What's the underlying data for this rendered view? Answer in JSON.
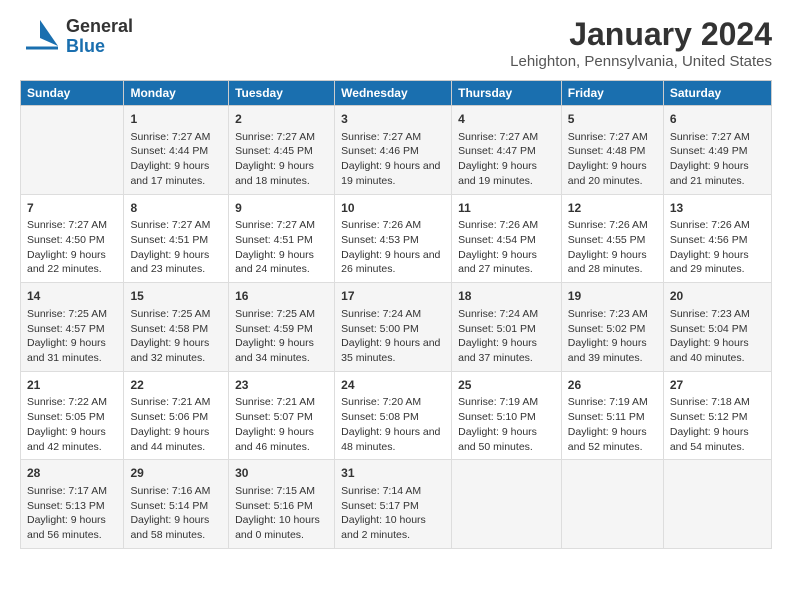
{
  "header": {
    "logo_general": "General",
    "logo_blue": "Blue",
    "title": "January 2024",
    "subtitle": "Lehighton, Pennsylvania, United States"
  },
  "columns": [
    "Sunday",
    "Monday",
    "Tuesday",
    "Wednesday",
    "Thursday",
    "Friday",
    "Saturday"
  ],
  "weeks": [
    [
      {
        "day": "",
        "sunrise": "",
        "sunset": "",
        "daylight": ""
      },
      {
        "day": "1",
        "sunrise": "Sunrise: 7:27 AM",
        "sunset": "Sunset: 4:44 PM",
        "daylight": "Daylight: 9 hours and 17 minutes."
      },
      {
        "day": "2",
        "sunrise": "Sunrise: 7:27 AM",
        "sunset": "Sunset: 4:45 PM",
        "daylight": "Daylight: 9 hours and 18 minutes."
      },
      {
        "day": "3",
        "sunrise": "Sunrise: 7:27 AM",
        "sunset": "Sunset: 4:46 PM",
        "daylight": "Daylight: 9 hours and 19 minutes."
      },
      {
        "day": "4",
        "sunrise": "Sunrise: 7:27 AM",
        "sunset": "Sunset: 4:47 PM",
        "daylight": "Daylight: 9 hours and 19 minutes."
      },
      {
        "day": "5",
        "sunrise": "Sunrise: 7:27 AM",
        "sunset": "Sunset: 4:48 PM",
        "daylight": "Daylight: 9 hours and 20 minutes."
      },
      {
        "day": "6",
        "sunrise": "Sunrise: 7:27 AM",
        "sunset": "Sunset: 4:49 PM",
        "daylight": "Daylight: 9 hours and 21 minutes."
      }
    ],
    [
      {
        "day": "7",
        "sunrise": "Sunrise: 7:27 AM",
        "sunset": "Sunset: 4:50 PM",
        "daylight": "Daylight: 9 hours and 22 minutes."
      },
      {
        "day": "8",
        "sunrise": "Sunrise: 7:27 AM",
        "sunset": "Sunset: 4:51 PM",
        "daylight": "Daylight: 9 hours and 23 minutes."
      },
      {
        "day": "9",
        "sunrise": "Sunrise: 7:27 AM",
        "sunset": "Sunset: 4:51 PM",
        "daylight": "Daylight: 9 hours and 24 minutes."
      },
      {
        "day": "10",
        "sunrise": "Sunrise: 7:26 AM",
        "sunset": "Sunset: 4:53 PM",
        "daylight": "Daylight: 9 hours and 26 minutes."
      },
      {
        "day": "11",
        "sunrise": "Sunrise: 7:26 AM",
        "sunset": "Sunset: 4:54 PM",
        "daylight": "Daylight: 9 hours and 27 minutes."
      },
      {
        "day": "12",
        "sunrise": "Sunrise: 7:26 AM",
        "sunset": "Sunset: 4:55 PM",
        "daylight": "Daylight: 9 hours and 28 minutes."
      },
      {
        "day": "13",
        "sunrise": "Sunrise: 7:26 AM",
        "sunset": "Sunset: 4:56 PM",
        "daylight": "Daylight: 9 hours and 29 minutes."
      }
    ],
    [
      {
        "day": "14",
        "sunrise": "Sunrise: 7:25 AM",
        "sunset": "Sunset: 4:57 PM",
        "daylight": "Daylight: 9 hours and 31 minutes."
      },
      {
        "day": "15",
        "sunrise": "Sunrise: 7:25 AM",
        "sunset": "Sunset: 4:58 PM",
        "daylight": "Daylight: 9 hours and 32 minutes."
      },
      {
        "day": "16",
        "sunrise": "Sunrise: 7:25 AM",
        "sunset": "Sunset: 4:59 PM",
        "daylight": "Daylight: 9 hours and 34 minutes."
      },
      {
        "day": "17",
        "sunrise": "Sunrise: 7:24 AM",
        "sunset": "Sunset: 5:00 PM",
        "daylight": "Daylight: 9 hours and 35 minutes."
      },
      {
        "day": "18",
        "sunrise": "Sunrise: 7:24 AM",
        "sunset": "Sunset: 5:01 PM",
        "daylight": "Daylight: 9 hours and 37 minutes."
      },
      {
        "day": "19",
        "sunrise": "Sunrise: 7:23 AM",
        "sunset": "Sunset: 5:02 PM",
        "daylight": "Daylight: 9 hours and 39 minutes."
      },
      {
        "day": "20",
        "sunrise": "Sunrise: 7:23 AM",
        "sunset": "Sunset: 5:04 PM",
        "daylight": "Daylight: 9 hours and 40 minutes."
      }
    ],
    [
      {
        "day": "21",
        "sunrise": "Sunrise: 7:22 AM",
        "sunset": "Sunset: 5:05 PM",
        "daylight": "Daylight: 9 hours and 42 minutes."
      },
      {
        "day": "22",
        "sunrise": "Sunrise: 7:21 AM",
        "sunset": "Sunset: 5:06 PM",
        "daylight": "Daylight: 9 hours and 44 minutes."
      },
      {
        "day": "23",
        "sunrise": "Sunrise: 7:21 AM",
        "sunset": "Sunset: 5:07 PM",
        "daylight": "Daylight: 9 hours and 46 minutes."
      },
      {
        "day": "24",
        "sunrise": "Sunrise: 7:20 AM",
        "sunset": "Sunset: 5:08 PM",
        "daylight": "Daylight: 9 hours and 48 minutes."
      },
      {
        "day": "25",
        "sunrise": "Sunrise: 7:19 AM",
        "sunset": "Sunset: 5:10 PM",
        "daylight": "Daylight: 9 hours and 50 minutes."
      },
      {
        "day": "26",
        "sunrise": "Sunrise: 7:19 AM",
        "sunset": "Sunset: 5:11 PM",
        "daylight": "Daylight: 9 hours and 52 minutes."
      },
      {
        "day": "27",
        "sunrise": "Sunrise: 7:18 AM",
        "sunset": "Sunset: 5:12 PM",
        "daylight": "Daylight: 9 hours and 54 minutes."
      }
    ],
    [
      {
        "day": "28",
        "sunrise": "Sunrise: 7:17 AM",
        "sunset": "Sunset: 5:13 PM",
        "daylight": "Daylight: 9 hours and 56 minutes."
      },
      {
        "day": "29",
        "sunrise": "Sunrise: 7:16 AM",
        "sunset": "Sunset: 5:14 PM",
        "daylight": "Daylight: 9 hours and 58 minutes."
      },
      {
        "day": "30",
        "sunrise": "Sunrise: 7:15 AM",
        "sunset": "Sunset: 5:16 PM",
        "daylight": "Daylight: 10 hours and 0 minutes."
      },
      {
        "day": "31",
        "sunrise": "Sunrise: 7:14 AM",
        "sunset": "Sunset: 5:17 PM",
        "daylight": "Daylight: 10 hours and 2 minutes."
      },
      {
        "day": "",
        "sunrise": "",
        "sunset": "",
        "daylight": ""
      },
      {
        "day": "",
        "sunrise": "",
        "sunset": "",
        "daylight": ""
      },
      {
        "day": "",
        "sunrise": "",
        "sunset": "",
        "daylight": ""
      }
    ]
  ]
}
